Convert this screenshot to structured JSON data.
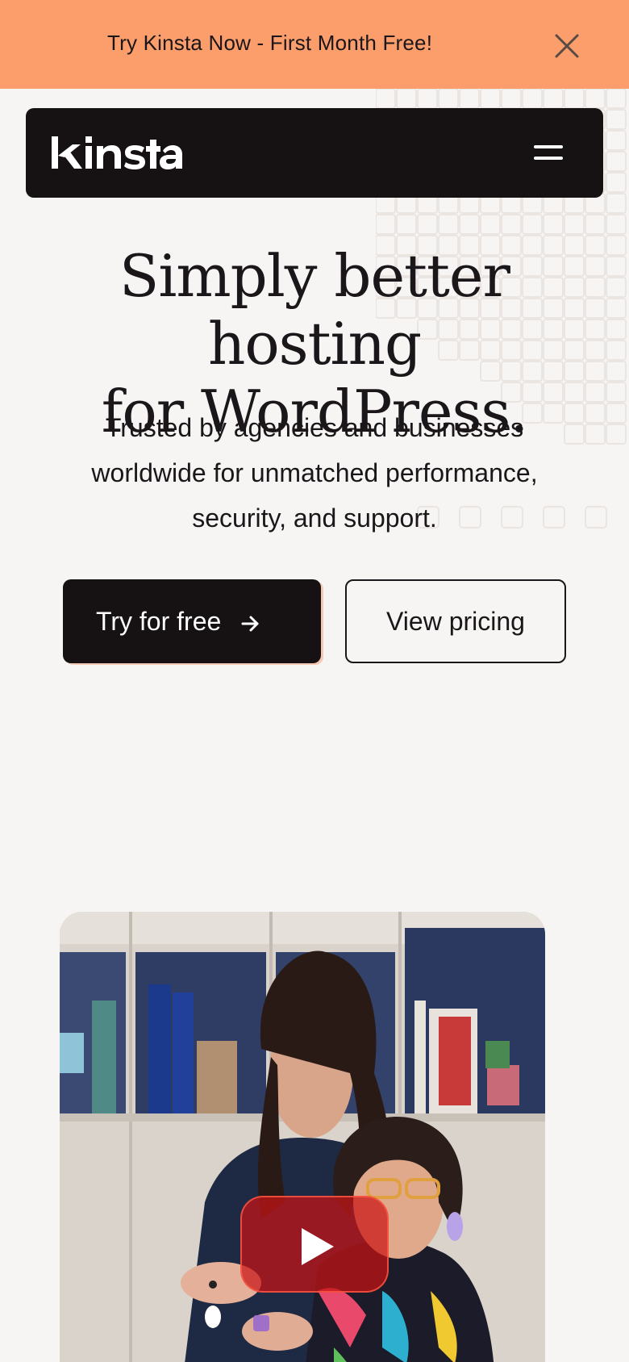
{
  "promo": {
    "text": "Try Kinsta Now - First Month Free!",
    "close_icon": "close-icon"
  },
  "nav": {
    "logo_text": "kinsta",
    "menu_icon": "hamburger-menu-icon"
  },
  "hero": {
    "title_line1": "Simply better hosting",
    "title_line2": "for WordPress.",
    "subtitle_line1": "Trusted by agencies and businesses",
    "subtitle_line2": "worldwide for unmatched performance,",
    "subtitle_line3": "security, and support.",
    "primary_button": "Try for free",
    "primary_button_icon": "arrow-right-icon",
    "secondary_button": "View pricing"
  },
  "video": {
    "play_icon": "play-icon"
  },
  "colors": {
    "promo_bg": "#fb9e6c",
    "nav_bg": "#161214",
    "page_bg": "#f7f5f3",
    "text": "#1a1619",
    "play_red": "#c81414"
  }
}
